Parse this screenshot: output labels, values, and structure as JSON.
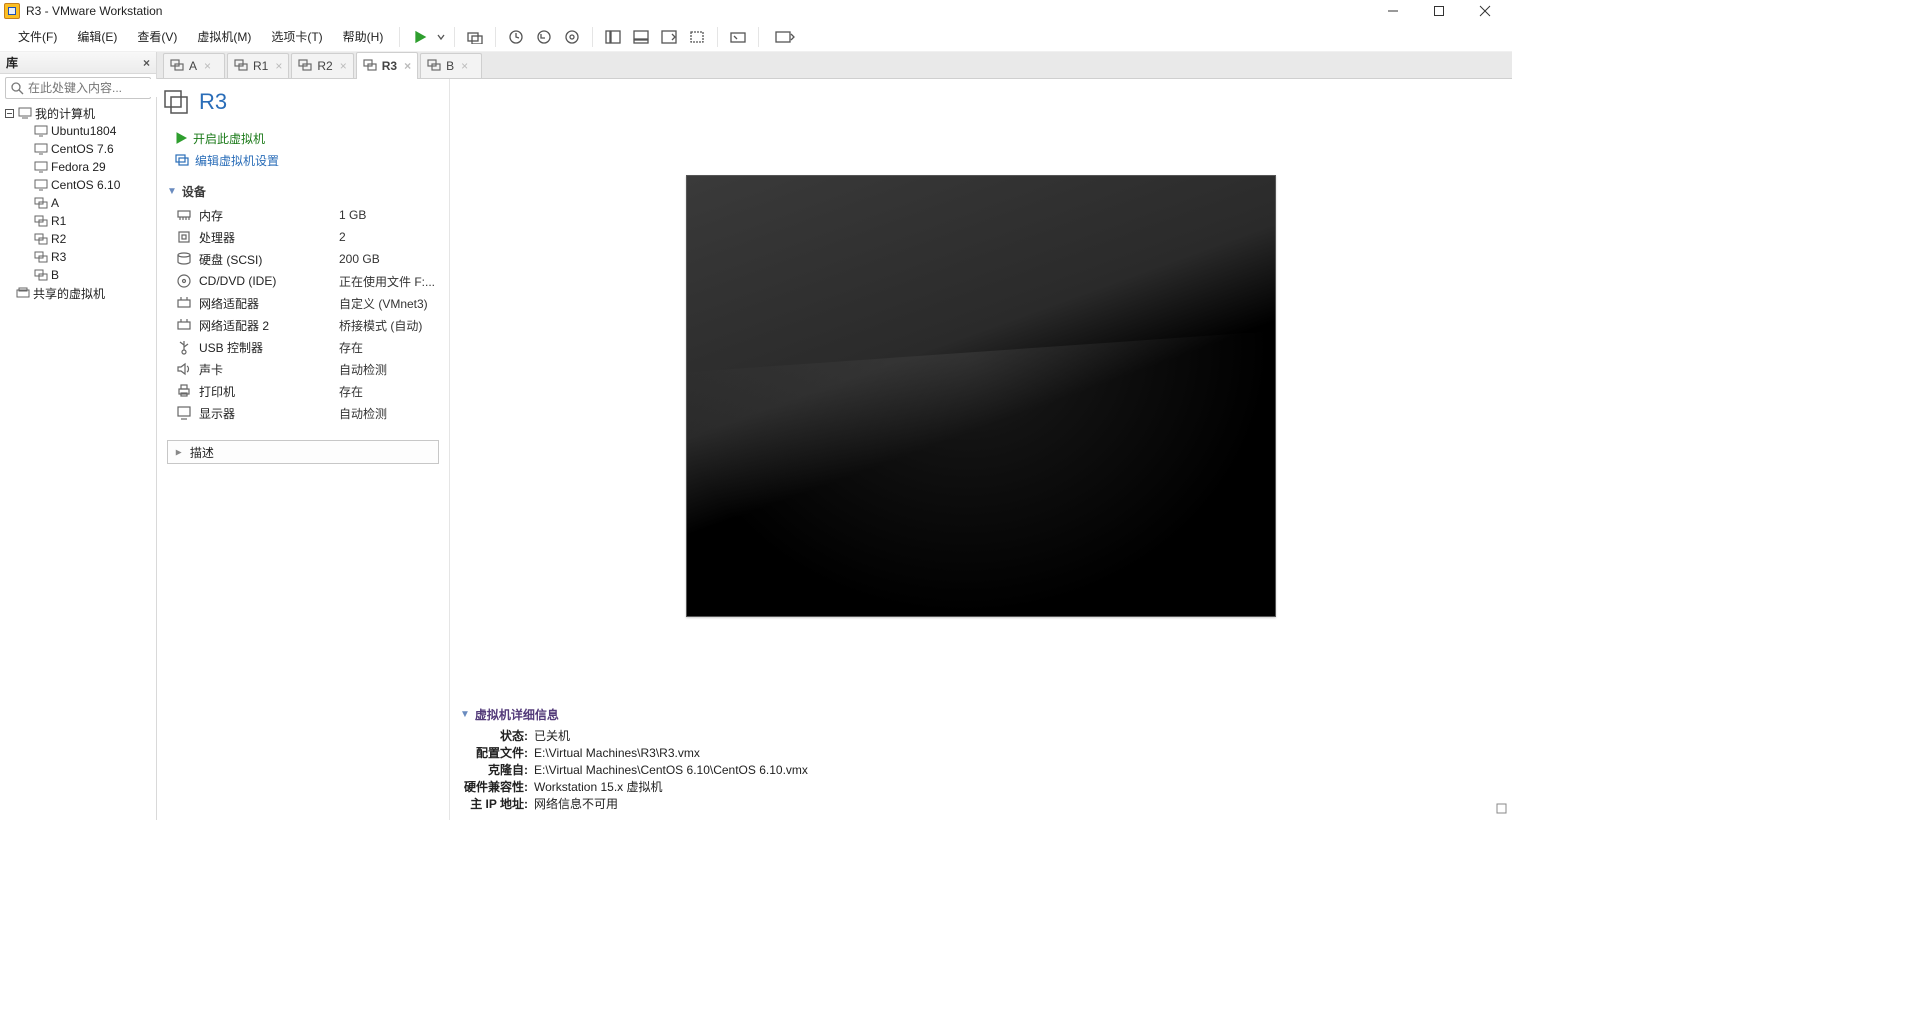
{
  "window": {
    "title": "R3 - VMware Workstation"
  },
  "menu": {
    "file": "文件(F)",
    "edit": "编辑(E)",
    "view": "查看(V)",
    "vm": "虚拟机(M)",
    "tabs": "选项卡(T)",
    "help": "帮助(H)"
  },
  "library": {
    "header": "库",
    "search_placeholder": "在此处键入内容...",
    "root": "我的计算机",
    "items": [
      {
        "label": "Ubuntu1804",
        "icon": "vm"
      },
      {
        "label": "CentOS 7.6",
        "icon": "vm"
      },
      {
        "label": "Fedora 29",
        "icon": "vm"
      },
      {
        "label": "CentOS 6.10",
        "icon": "vm"
      },
      {
        "label": "A",
        "icon": "group"
      },
      {
        "label": "R1",
        "icon": "group"
      },
      {
        "label": "R2",
        "icon": "group"
      },
      {
        "label": "R3",
        "icon": "group"
      },
      {
        "label": "B",
        "icon": "group"
      }
    ],
    "shared": "共享的虚拟机"
  },
  "tabs": [
    {
      "label": "A"
    },
    {
      "label": "R1"
    },
    {
      "label": "R2"
    },
    {
      "label": "R3",
      "active": true
    },
    {
      "label": "B"
    }
  ],
  "vm": {
    "title": "R3",
    "actions": {
      "poweron": "开启此虚拟机",
      "edit": "编辑虚拟机设置"
    },
    "devices_header": "设备",
    "devices": [
      {
        "label": "内存",
        "value": "1 GB",
        "icon": "memory"
      },
      {
        "label": "处理器",
        "value": "2",
        "icon": "cpu"
      },
      {
        "label": "硬盘 (SCSI)",
        "value": "200 GB",
        "icon": "disk"
      },
      {
        "label": "CD/DVD (IDE)",
        "value": "正在使用文件 F:...",
        "icon": "cd"
      },
      {
        "label": "网络适配器",
        "value": "自定义 (VMnet3)",
        "icon": "net"
      },
      {
        "label": "网络适配器 2",
        "value": "桥接模式 (自动)",
        "icon": "net"
      },
      {
        "label": "USB 控制器",
        "value": "存在",
        "icon": "usb"
      },
      {
        "label": "声卡",
        "value": "自动检测",
        "icon": "sound"
      },
      {
        "label": "打印机",
        "value": "存在",
        "icon": "printer"
      },
      {
        "label": "显示器",
        "value": "自动检测",
        "icon": "display"
      }
    ],
    "description_header": "描述"
  },
  "details": {
    "header": "虚拟机详细信息",
    "rows": [
      {
        "label": "状态:",
        "value": "已关机"
      },
      {
        "label": "配置文件:",
        "value": "E:\\Virtual Machines\\R3\\R3.vmx"
      },
      {
        "label": "克隆自:",
        "value": "E:\\Virtual Machines\\CentOS 6.10\\CentOS 6.10.vmx"
      },
      {
        "label": "硬件兼容性:",
        "value": "Workstation 15.x 虚拟机"
      },
      {
        "label": "主 IP 地址:",
        "value": "网络信息不可用"
      }
    ]
  }
}
